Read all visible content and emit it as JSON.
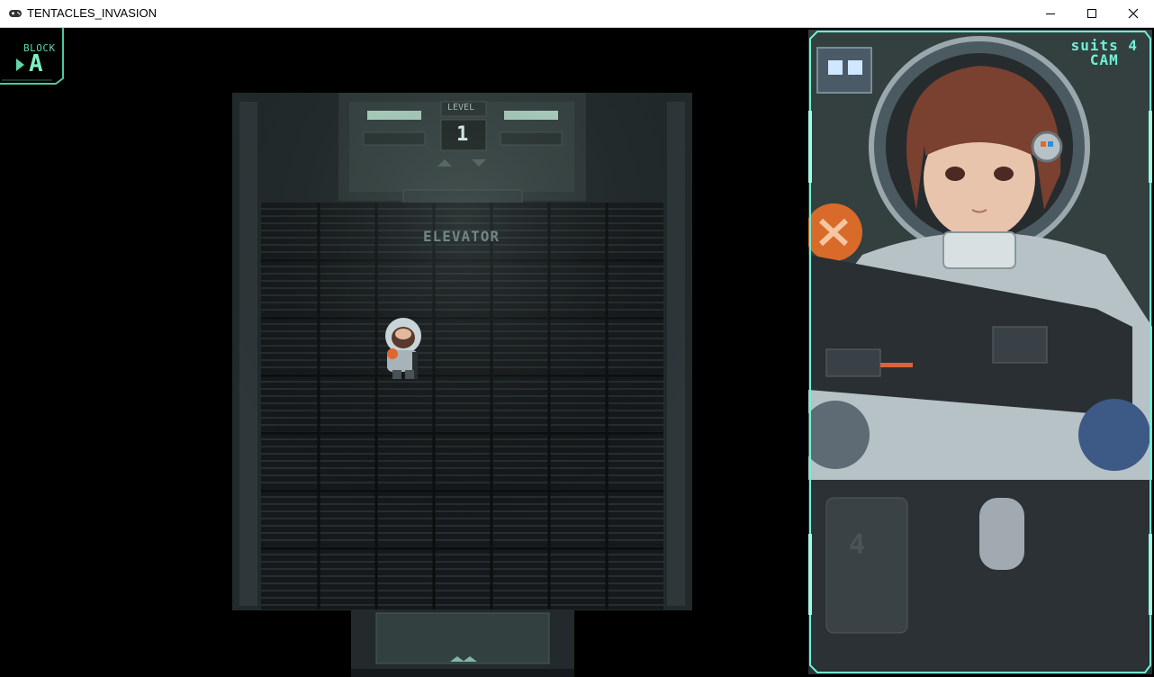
{
  "window": {
    "title": "TENTACLES_INVASION",
    "controls": {
      "minimize": "—",
      "maximize": "☐",
      "close": "✕"
    }
  },
  "hud": {
    "block_label": "BLOCK",
    "block_value": "A"
  },
  "map": {
    "level_label": "LEVEL",
    "level_value": "1",
    "elevator_label": "ELEVATOR"
  },
  "camera": {
    "line1": "suits 4",
    "line2": "CAM",
    "suit_number": "4"
  },
  "colors": {
    "hud_accent": "#5fd6a6",
    "cam_frame": "#7ff0c0",
    "floor": "#1c2124",
    "wall": "#2b3436"
  }
}
